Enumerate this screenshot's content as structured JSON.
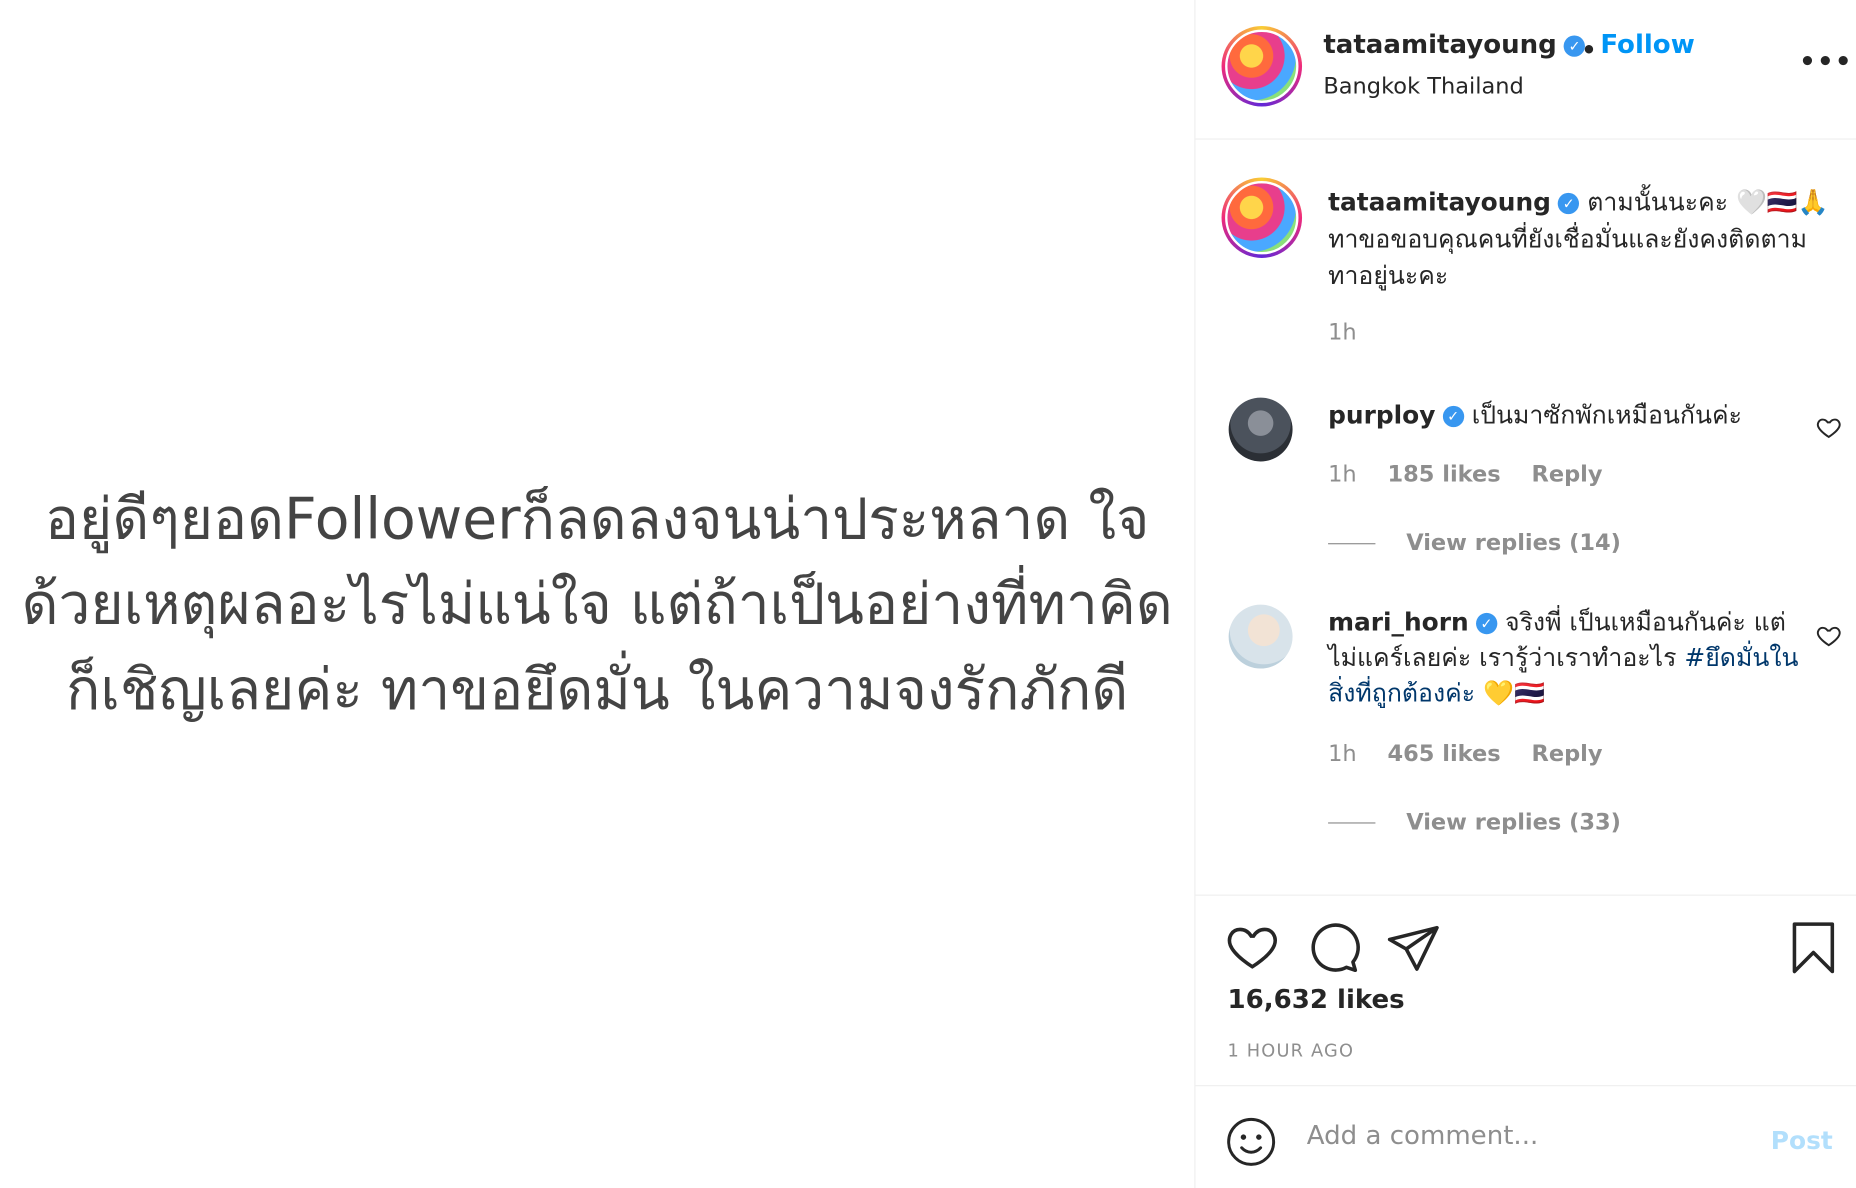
{
  "post_image": {
    "lines": [
      "อยู่ดีๆยอดFollowerก็ลดลงจนน่าประหลาด ใจ",
      "ด้วยเหตุผลอะไรไม่แน่ใจ แต่ถ้าเป็นอย่างที่ทาคิด",
      "ก็เชิญเลยค่ะ ทาขอยึดมั่น ในความจงรักภักดี"
    ]
  },
  "header": {
    "username": "tataamitayoung",
    "verified_icon": "✓",
    "separator": "•",
    "follow_label": "Follow",
    "location": "Bangkok Thailand",
    "more_label": "•••"
  },
  "caption": {
    "username": "tataamitayoung",
    "verified_icon": "✓",
    "text": "ตามนั้นนะคะ 🤍🇹🇭🙏 ทาขอขอบคุณคนที่ยังเชื่อมั่นและยังคงติดตามทาอยู่นะคะ",
    "time": "1h"
  },
  "comments": [
    {
      "username": "purploy",
      "verified_icon": "✓",
      "text": "เป็นมาซักพักเหมือนกันค่ะ",
      "time": "1h",
      "likes": "185 likes",
      "reply_label": "Reply",
      "view_replies": "View replies (14)"
    },
    {
      "username": "mari_horn",
      "verified_icon": "✓",
      "text": "จริงพี่ เป็นเหมือนกันค่ะ แต่ไม่แคร์เลยค่ะ เรารู้ว่าเราทำอะไร",
      "hashtag": "#ยึดมั่นในสิ่งที่ถูกต้องค่ะ",
      "emoji": "💛🇹🇭",
      "time": "1h",
      "likes": "465 likes",
      "reply_label": "Reply",
      "view_replies": "View replies (33)"
    }
  ],
  "actions": {
    "likes": "16,632 likes",
    "time_ago": "1 HOUR AGO"
  },
  "add_comment": {
    "placeholder": "Add a comment...",
    "post_label": "Post"
  },
  "colors": {
    "follow": "#0095f6",
    "verified": "#3897f0",
    "muted": "#8e8e8e",
    "post_disabled": "#b2dffc"
  }
}
